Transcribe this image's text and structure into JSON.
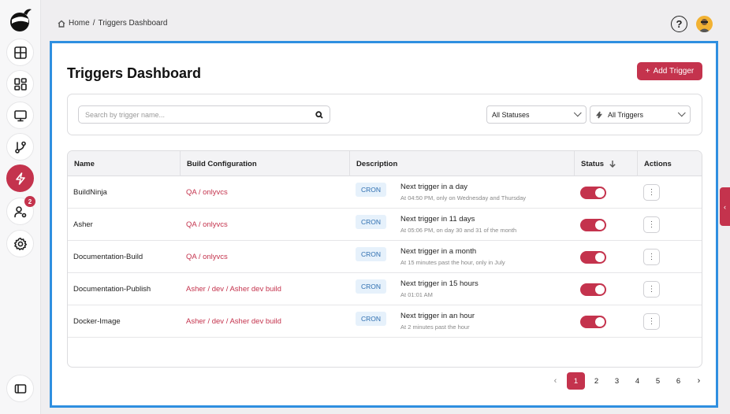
{
  "breadcrumb": {
    "home": "Home",
    "separator": "/",
    "current": "Triggers Dashboard"
  },
  "header": {
    "help_glyph": "?"
  },
  "sidebar": {
    "badge_count": "2",
    "items": [
      {
        "icon": "grid-dashboard-icon"
      },
      {
        "icon": "widgets-icon"
      },
      {
        "icon": "monitor-icon"
      },
      {
        "icon": "git-branch-icon"
      },
      {
        "icon": "lightning-icon",
        "active": true
      },
      {
        "icon": "user-settings-icon"
      },
      {
        "icon": "gear-icon"
      }
    ]
  },
  "page": {
    "title": "Triggers Dashboard",
    "add_button": "Add Trigger",
    "add_button_icon": "+"
  },
  "filters": {
    "search_placeholder": "Search by trigger name...",
    "status_select": "All Statuses",
    "trigger_select": "All Triggers"
  },
  "table": {
    "headers": {
      "name": "Name",
      "build": "Build Configuration",
      "description": "Description",
      "status": "Status",
      "actions": "Actions"
    },
    "rows": [
      {
        "name": "BuildNinja",
        "build": "QA / onlyvcs",
        "tag": "CRON",
        "desc_main": "Next trigger in a day",
        "desc_sub": "At 04:50 PM, only on Wednesday and Thursday",
        "enabled": true
      },
      {
        "name": "Asher",
        "build": "QA / onlyvcs",
        "tag": "CRON",
        "desc_main": "Next trigger in 11 days",
        "desc_sub": "At 05:06 PM, on day 30 and 31 of the month",
        "enabled": true
      },
      {
        "name": "Documentation-Build",
        "build": "QA / onlyvcs",
        "tag": "CRON",
        "desc_main": "Next trigger in a month",
        "desc_sub": "At 15 minutes past the hour, only in July",
        "enabled": true
      },
      {
        "name": "Documentation-Publish",
        "build": "Asher / dev / Asher dev build",
        "tag": "CRON",
        "desc_main": "Next trigger in 15 hours",
        "desc_sub": "At 01:01 AM",
        "enabled": true
      },
      {
        "name": "Docker-Image",
        "build": "Asher / dev / Asher dev build",
        "tag": "CRON",
        "desc_main": "Next trigger in an hour",
        "desc_sub": "At 2 minutes past the hour",
        "enabled": true
      }
    ],
    "kebab_glyph": "⋮"
  },
  "pagination": {
    "prev": "‹",
    "next": "›",
    "pages": [
      "1",
      "2",
      "3",
      "4",
      "5",
      "6"
    ],
    "current": "1"
  },
  "colors": {
    "accent": "#c4334d",
    "frame": "#2f8fe0",
    "cron_bg": "#e6f1fb"
  }
}
